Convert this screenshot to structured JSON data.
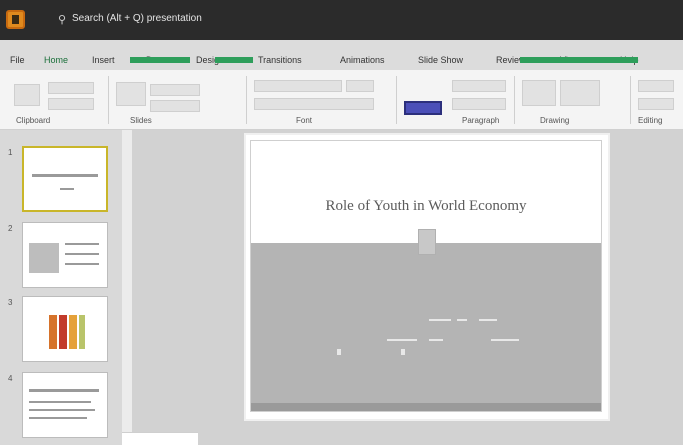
{
  "window": {
    "title": "Search (Alt + Q) presentation"
  },
  "ribbon": {
    "tabs": [
      "File",
      "Home",
      "Insert",
      "Draw",
      "Design",
      "Transitions",
      "Animations",
      "Slide Show",
      "Review",
      "View",
      "Help"
    ],
    "active_tab": "Home",
    "groups": [
      "Clipboard",
      "Slides",
      "Font",
      "Paragraph",
      "Drawing",
      "Editing"
    ],
    "accent_color": "#4b4fb8",
    "brand_color": "#2e9e5b"
  },
  "thumbnails": {
    "numbers": [
      "1",
      "2",
      "3",
      "4"
    ],
    "selected_index": 0
  },
  "slide": {
    "title": "Role of Youth in World Economy",
    "body_lines": [
      "",
      ""
    ]
  },
  "icons": {
    "app": "powerpoint-app-icon",
    "search": "search-icon"
  }
}
